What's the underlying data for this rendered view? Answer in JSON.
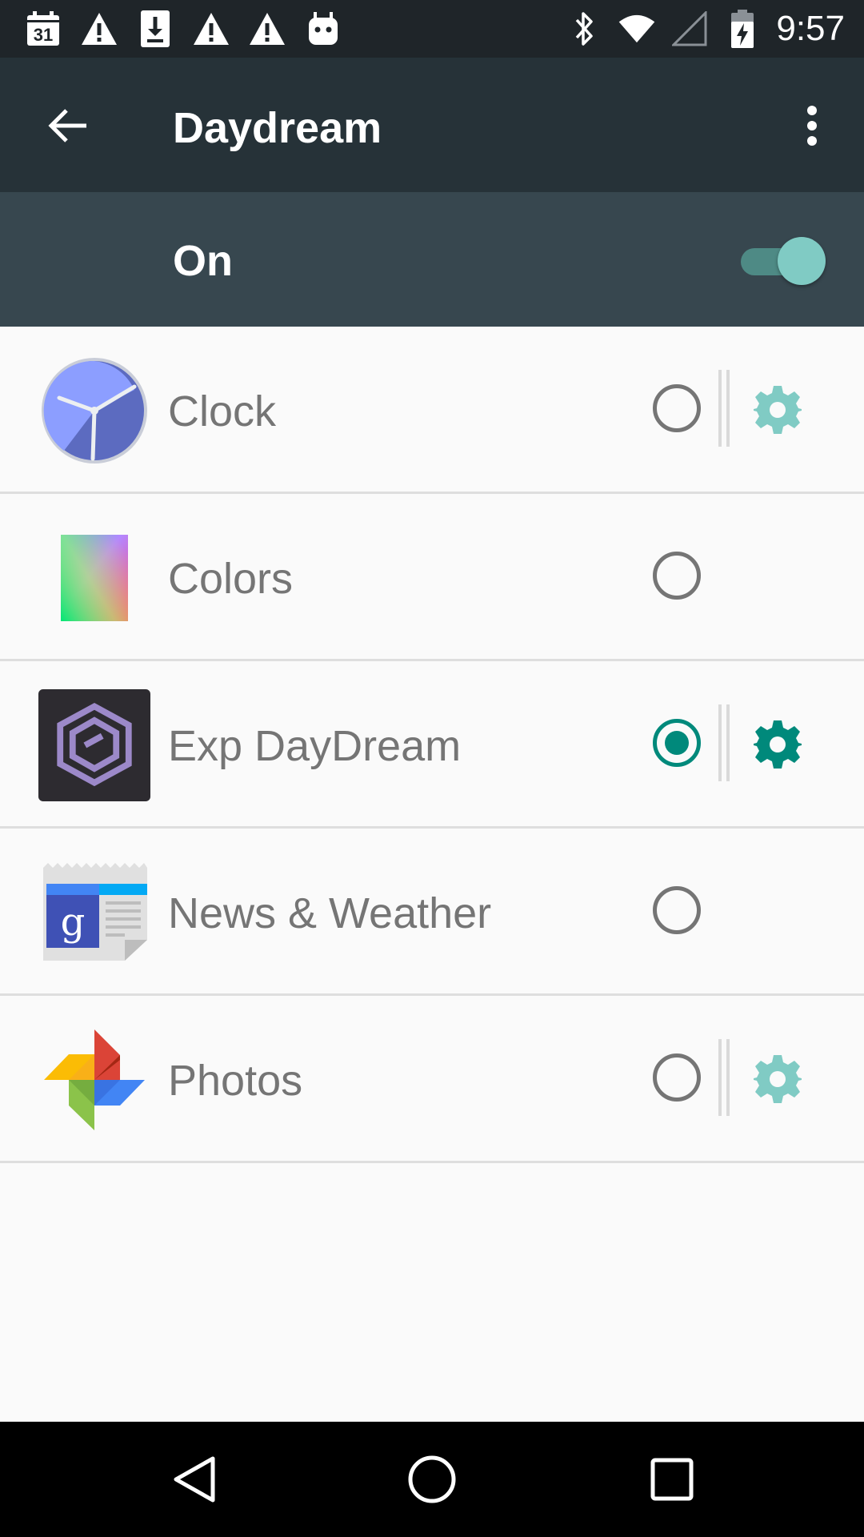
{
  "status_bar": {
    "time": "9:57",
    "left_icons": [
      "calendar-icon",
      "warning-icon",
      "download-icon",
      "warning-icon",
      "warning-icon",
      "android-icon"
    ],
    "calendar_day": "31",
    "right_icons": [
      "bluetooth-icon",
      "wifi-icon",
      "signal-icon",
      "battery-charging-icon"
    ]
  },
  "app_bar": {
    "title": "Daydream",
    "back_icon": "arrow-back-icon",
    "menu_icon": "more-vert-icon"
  },
  "master_switch": {
    "label": "On",
    "enabled": true
  },
  "daydreams": [
    {
      "label": "Clock",
      "icon": "clock-icon",
      "selected": false,
      "has_settings": true,
      "settings_enabled": false
    },
    {
      "label": "Colors",
      "icon": "colors-icon",
      "selected": false,
      "has_settings": false
    },
    {
      "label": "Exp DayDream",
      "icon": "exp-daydream-icon",
      "selected": true,
      "has_settings": true,
      "settings_enabled": true
    },
    {
      "label": "News & Weather",
      "icon": "news-weather-icon",
      "selected": false,
      "has_settings": false
    },
    {
      "label": "Photos",
      "icon": "photos-icon",
      "selected": false,
      "has_settings": true,
      "settings_enabled": false
    }
  ],
  "nav_bar": {
    "buttons": [
      "back-triangle-icon",
      "home-circle-icon",
      "recents-square-icon"
    ]
  },
  "colors": {
    "status_bar": "#1f2529",
    "app_bar": "#263238",
    "master_bar": "#37474f",
    "accent": "#00897b",
    "accent_light": "#80cbc4",
    "text_secondary": "#757575",
    "background": "#fafafa"
  }
}
